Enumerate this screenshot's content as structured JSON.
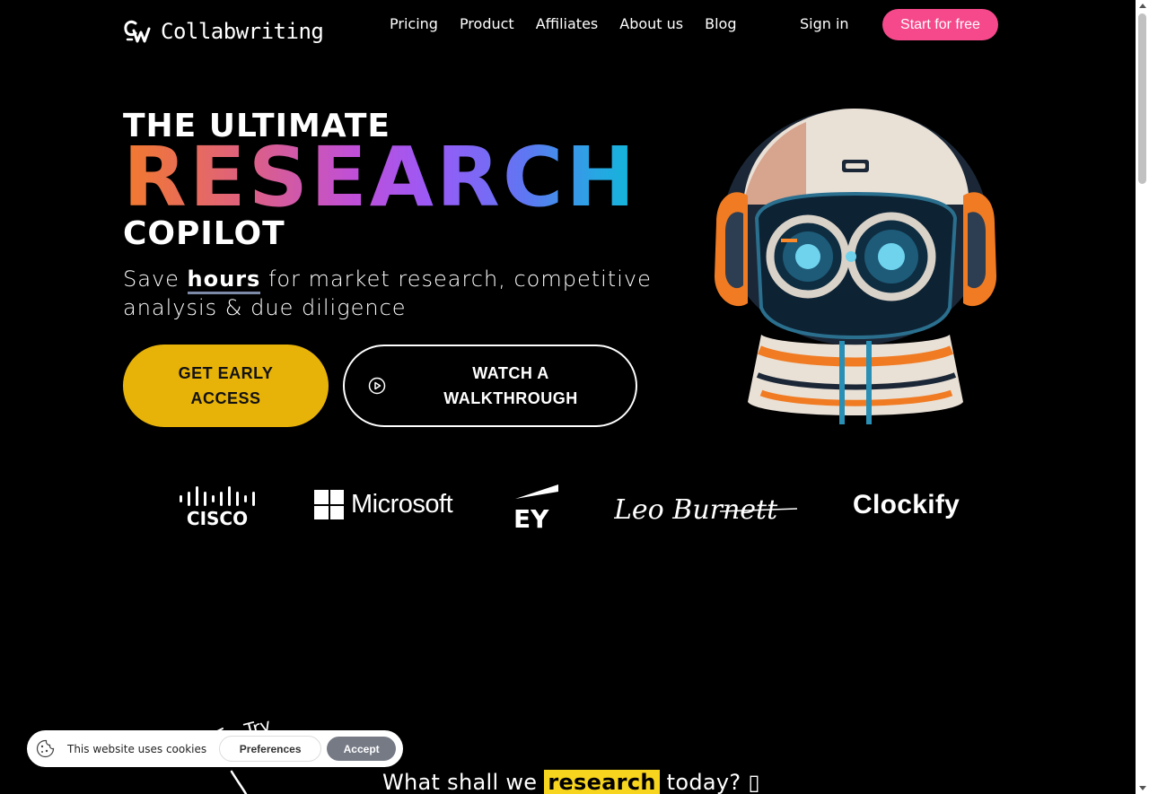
{
  "header": {
    "brand": "Collabwriting",
    "nav": [
      "Pricing",
      "Product",
      "Affiliates",
      "About us",
      "Blog"
    ],
    "sign_in": "Sign in",
    "cta": "Start for free"
  },
  "hero": {
    "line1": "THE ULTIMATE",
    "line2": "RESEARCH",
    "line3": "COPILOT",
    "subtitle_pre": "Save ",
    "subtitle_highlight": "hours",
    "subtitle_post": " for market research, competitive analysis & due diligence",
    "primary_button": "GET EARLY ACCESS",
    "secondary_button": "WATCH A WALKTHROUGH"
  },
  "logos": {
    "cisco": "CISCO",
    "microsoft": "Microsoft",
    "ey": "EY",
    "leo": "Leo Burnett",
    "clockify": "Clockify"
  },
  "bottom": {
    "handwritten": "Try",
    "heading_pre": "What shall we ",
    "heading_highlight": "research",
    "heading_post": " today? ▯"
  },
  "cookie": {
    "text": "This website uses cookies",
    "preferences": "Preferences",
    "accept": "Accept"
  },
  "colors": {
    "cta_pink": "#f5498b",
    "access_yellow": "#e8b308",
    "highlight_yellow": "#f7d51e"
  }
}
